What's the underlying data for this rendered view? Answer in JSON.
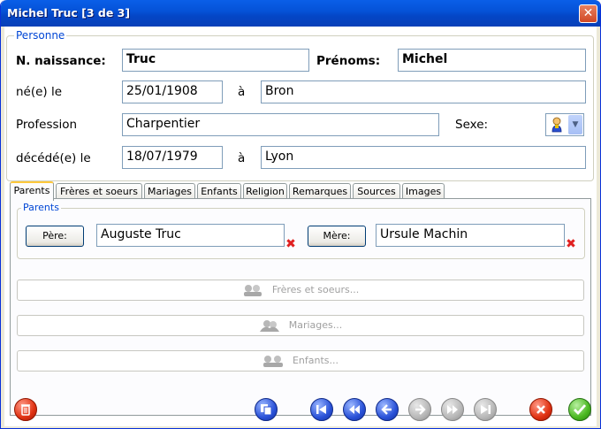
{
  "window": {
    "title": "Michel Truc [3 de 3]",
    "close_glyph": "✕"
  },
  "personne": {
    "legend": "Personne",
    "nom_label": "N. naissance:",
    "nom_value": "Truc",
    "prenoms_label": "Prénoms:",
    "prenoms_value": "Michel",
    "ne_label": "né(e) le",
    "ne_date": "25/01/1908",
    "a_label": "à",
    "ne_lieu": "Bron",
    "profession_label": "Profession",
    "profession_value": "Charpentier",
    "sexe_label": "Sexe:",
    "sexe_icon": "male-person-icon",
    "deces_label": "décédé(e) le",
    "deces_date": "18/07/1979",
    "deces_lieu": "Lyon"
  },
  "tabs": [
    {
      "label": "Parents",
      "active": true
    },
    {
      "label": "Frères et soeurs"
    },
    {
      "label": "Mariages"
    },
    {
      "label": "Enfants"
    },
    {
      "label": "Religion"
    },
    {
      "label": "Remarques"
    },
    {
      "label": "Sources"
    },
    {
      "label": "Images"
    }
  ],
  "parents": {
    "legend": "Parents",
    "pere_button": "Père:",
    "pere_value": "Auguste Truc",
    "mere_button": "Mère:",
    "mere_value": "Ursule Machin",
    "clear_glyph": "✖"
  },
  "shortcuts": {
    "freres": "Frères et soeurs...",
    "mariages": "Mariages...",
    "enfants": "Enfants..."
  },
  "toolbar": {
    "delete_icon": "trash-icon",
    "copy_icon": "copy-icon",
    "first_icon": "first-record-icon",
    "prev_fast_icon": "rewind-icon",
    "prev_icon": "previous-icon",
    "next_icon": "next-icon",
    "next_fast_icon": "fast-forward-icon",
    "last_icon": "last-record-icon",
    "cancel_icon": "cancel-icon",
    "ok_icon": "ok-icon"
  },
  "colors": {
    "title_bar": "#0553d8",
    "legend": "#0046d5",
    "clear": "#e02020"
  }
}
